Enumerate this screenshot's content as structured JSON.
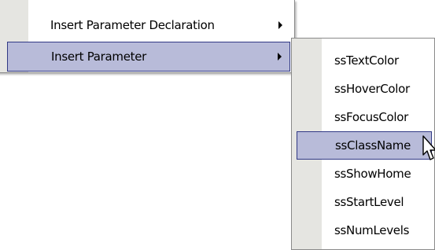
{
  "parent_menu": {
    "items": [
      {
        "label": "Insert Parameter Declaration",
        "has_submenu": true,
        "selected": false
      },
      {
        "label": "Insert Parameter",
        "has_submenu": true,
        "selected": true
      }
    ]
  },
  "submenu": {
    "items": [
      {
        "label": "ssTextColor",
        "selected": false
      },
      {
        "label": "ssHoverColor",
        "selected": false
      },
      {
        "label": "ssFocusColor",
        "selected": false
      },
      {
        "label": "ssClassName",
        "selected": true
      },
      {
        "label": "ssShowHome",
        "selected": false
      },
      {
        "label": "ssStartLevel",
        "selected": false
      },
      {
        "label": "ssNumLevels",
        "selected": false
      }
    ]
  },
  "colors": {
    "highlight_fill": "#b8bbd9",
    "highlight_border": "#313985",
    "gutter": "#e5e5e1",
    "menu_border": "#8a8a8a"
  },
  "cursor": {
    "icon": "arrow-cursor-icon"
  }
}
